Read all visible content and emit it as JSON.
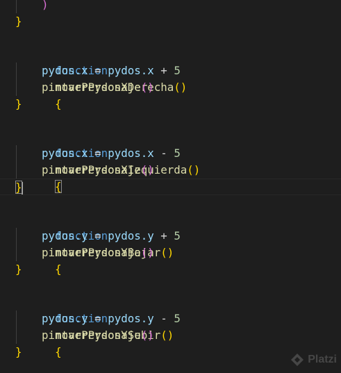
{
  "editor": {
    "lines": [
      {
        "indent": "    ",
        "text": ")"
      },
      {
        "text": "}"
      },
      {
        "text": ""
      },
      {
        "keyword": "function",
        "name": "moverPydosXDerecha",
        "parens": "()",
        "brace": "{"
      },
      {
        "indent": "    ",
        "obj": "pydos",
        "prop": ".x",
        "op": " = ",
        "obj2": "pydos",
        "prop2": ".x",
        "op2": " + ",
        "num": "5"
      },
      {
        "indent": "    ",
        "call": "pintarPersonaje",
        "parens": "()"
      },
      {
        "text": "}"
      },
      {
        "text": ""
      },
      {
        "keyword": "function",
        "name": "moverPydosXIzquierda",
        "parens": "()",
        "brace": "{"
      },
      {
        "indent": "    ",
        "obj": "pydos",
        "prop": ".x",
        "op": " = ",
        "obj2": "pydos",
        "prop2": ".x",
        "op2": " - ",
        "num": "5"
      },
      {
        "indent": "    ",
        "call": "pintarPersonaje",
        "parens": "()"
      },
      {
        "text": "}"
      },
      {
        "text": ""
      },
      {
        "keyword": "function",
        "name": "moverPydosYBajar",
        "parens": "()",
        "brace": "{"
      },
      {
        "indent": "    ",
        "obj": "pydos",
        "prop": ".y",
        "op": " = ",
        "obj2": "pydos",
        "prop2": ".y",
        "op2": " + ",
        "num": "5"
      },
      {
        "indent": "    ",
        "call": "pintarPersonaje",
        "parens": "()"
      },
      {
        "text": "}"
      },
      {
        "text": ""
      },
      {
        "keyword": "function",
        "name": "moverPydosYSubir",
        "parens": "()",
        "brace": "{"
      },
      {
        "indent": "    ",
        "obj": "pydos",
        "prop": ".y",
        "op": " = ",
        "obj2": "pydos",
        "prop2": ".y",
        "op2": " - ",
        "num": "5"
      },
      {
        "indent": "    ",
        "call": "pintarPersonaje",
        "parens": "()"
      },
      {
        "text": "}"
      }
    ],
    "current_line": 11,
    "colors": {
      "background": "#1e1e1e",
      "keyword": "#569cd6",
      "function": "#dcdcaa",
      "variable": "#9cdcfe",
      "number": "#b5cea8",
      "bracket_level1": "#ffd700",
      "bracket_level2": "#da70d6"
    }
  },
  "watermark": {
    "icon": "platzi-logo-icon",
    "text": "Platzi"
  }
}
